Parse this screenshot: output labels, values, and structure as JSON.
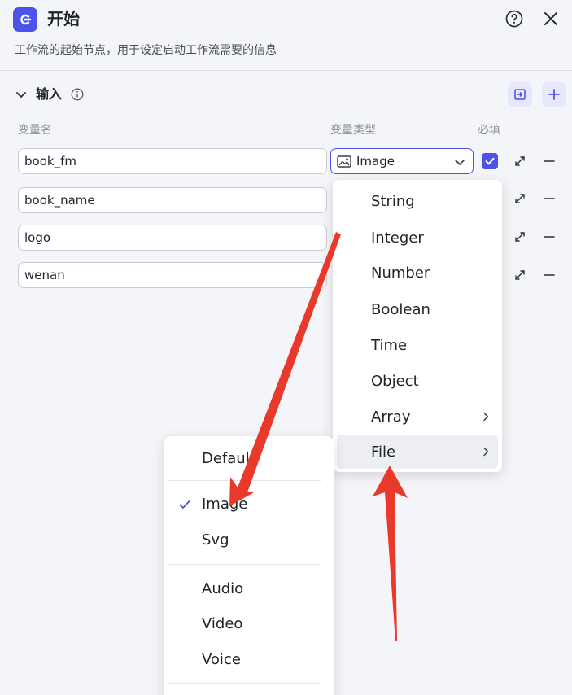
{
  "header": {
    "title": "开始",
    "description": "工作流的起始节点，用于设定启动工作流需要的信息",
    "icon": "start-node-icon",
    "accent": "#4d53e8"
  },
  "section": {
    "title": "输入",
    "columns": {
      "name": "变量名",
      "type": "变量类型",
      "required": "必填"
    }
  },
  "variables": [
    {
      "name": "book_fm"
    },
    {
      "name": "book_name"
    },
    {
      "name": "logo"
    },
    {
      "name": "wenan"
    }
  ],
  "type_select": {
    "value": "Image",
    "icon": "image-icon"
  },
  "type_menu": {
    "items": [
      "String",
      "Integer",
      "Number",
      "Boolean",
      "Time",
      "Object",
      "Array",
      "File"
    ],
    "active": "File"
  },
  "file_submenu": {
    "items": [
      "Default",
      "Image",
      "Svg",
      "Audio",
      "Video",
      "Voice"
    ],
    "selected": "Image"
  },
  "annotation_color": "#e8392b"
}
